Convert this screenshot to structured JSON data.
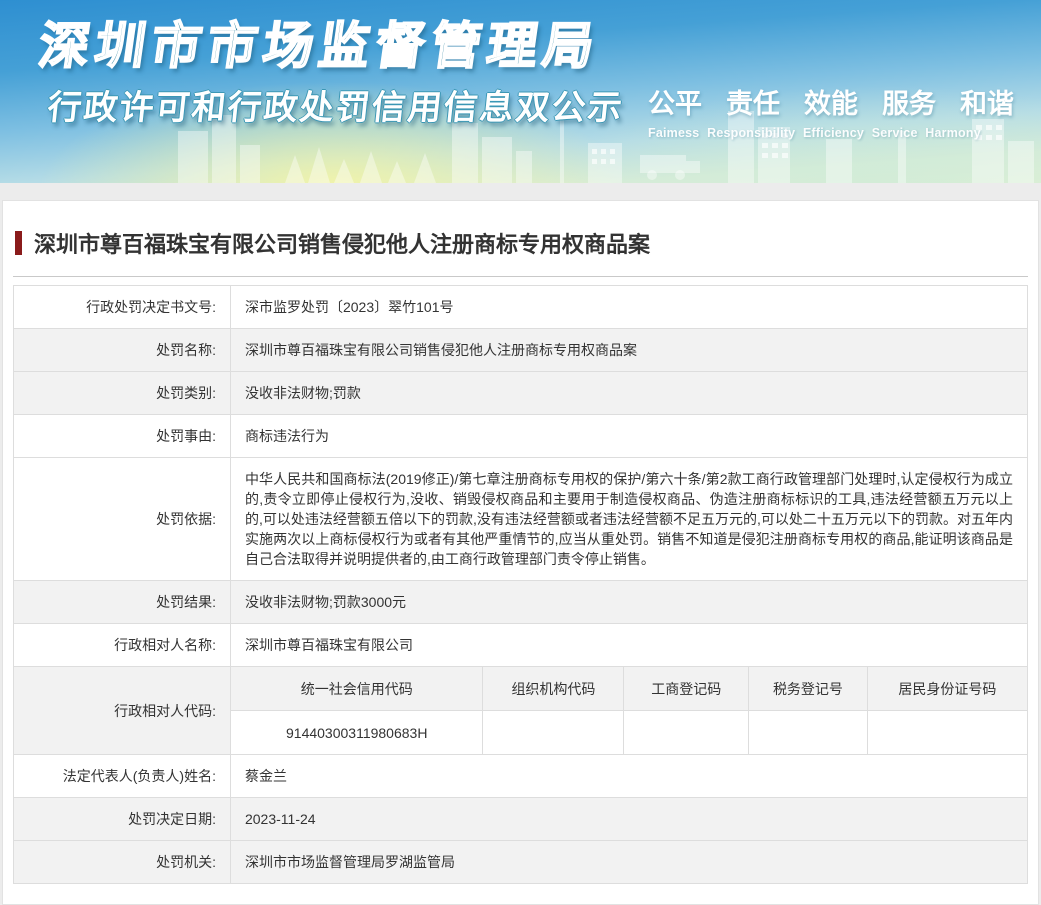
{
  "banner": {
    "title": "深圳市市场监督管理局",
    "subtitle": "行政许可和行政处罚信用信息双公示",
    "values_cn": [
      "公平",
      "责任",
      "效能",
      "服务",
      "和谐"
    ],
    "values_en": "Faimess  Responsibility  Efficiency  Service  Harmony",
    "accent_color": "#0f7292"
  },
  "page": {
    "case_title": "深圳市尊百福珠宝有限公司销售侵犯他人注册商标专用权商品案",
    "title_bar_color": "#8a1b1b"
  },
  "table": {
    "rows": [
      {
        "label": "行政处罚决定书文号:",
        "value": "深市监罗处罚〔2023〕翠竹101号"
      },
      {
        "label": "处罚名称:",
        "value": "深圳市尊百福珠宝有限公司销售侵犯他人注册商标专用权商品案"
      },
      {
        "label": "处罚类别:",
        "value": "没收非法财物;罚款"
      },
      {
        "label": "处罚事由:",
        "value": "商标违法行为"
      },
      {
        "label": "处罚依据:",
        "value": "中华人民共和国商标法(2019修正)/第七章注册商标专用权的保护/第六十条/第2款工商行政管理部门处理时,认定侵权行为成立的,责令立即停止侵权行为,没收、销毁侵权商品和主要用于制造侵权商品、伪造注册商标标识的工具,违法经营额五万元以上的,可以处违法经营额五倍以下的罚款,没有违法经营额或者违法经营额不足五万元的,可以处二十五万元以下的罚款。对五年内实施两次以上商标侵权行为或者有其他严重情节的,应当从重处罚。销售不知道是侵犯注册商标专用权的商品,能证明该商品是自己合法取得并说明提供者的,由工商行政管理部门责令停止销售。"
      },
      {
        "label": "处罚结果:",
        "value": "没收非法财物;罚款3000元"
      },
      {
        "label": "行政相对人名称:",
        "value": "深圳市尊百福珠宝有限公司"
      },
      {
        "label": "法定代表人(负责人)姓名:",
        "value": "蔡金兰"
      },
      {
        "label": "处罚决定日期:",
        "value": "2023-11-24"
      },
      {
        "label": "处罚机关:",
        "value": "深圳市市场监督管理局罗湖监管局"
      }
    ],
    "code_row": {
      "label": "行政相对人代码:",
      "columns": [
        "统一社会信用代码",
        "组织机构代码",
        "工商登记码",
        "税务登记号",
        "居民身份证号码"
      ],
      "values": [
        "91440300311980683H",
        "",
        "",
        "",
        ""
      ]
    }
  }
}
